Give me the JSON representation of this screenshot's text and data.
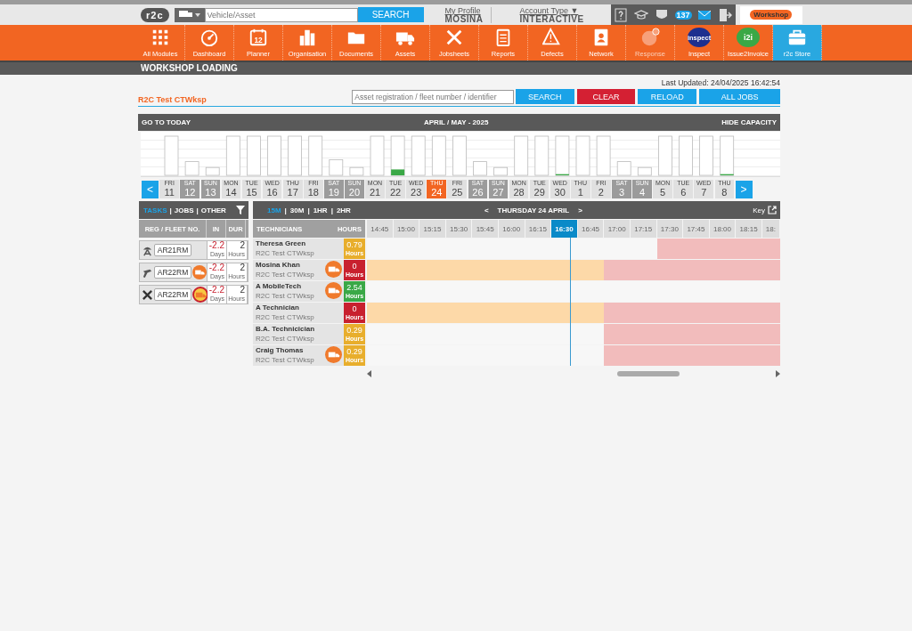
{
  "header": {
    "logo": "r2c",
    "search": {
      "placeholder": "Vehicle/Asset",
      "button": "SEARCH"
    },
    "profile": {
      "link": "My Profile",
      "name": "MOSINA"
    },
    "account": {
      "link": "Account Type",
      "caret": "▼",
      "value": "INTERACTIVE"
    },
    "notification_count": "137",
    "workshop_logo": "Workshop"
  },
  "nav": [
    {
      "label": "All Modules",
      "selected": false,
      "disabled": false
    },
    {
      "label": "Dashboard",
      "selected": false,
      "disabled": false
    },
    {
      "label": "Planner",
      "selected": false,
      "disabled": false,
      "icon_text": "12"
    },
    {
      "label": "Organisation",
      "selected": false,
      "disabled": false
    },
    {
      "label": "Documents",
      "selected": false,
      "disabled": false
    },
    {
      "label": "Assets",
      "selected": false,
      "disabled": false
    },
    {
      "label": "Jobsheets",
      "selected": false,
      "disabled": false
    },
    {
      "label": "Reports",
      "selected": false,
      "disabled": false
    },
    {
      "label": "Defects",
      "selected": false,
      "disabled": false
    },
    {
      "label": "Network",
      "selected": false,
      "disabled": false
    },
    {
      "label": "Response",
      "selected": false,
      "disabled": true
    },
    {
      "label": "Inspect",
      "selected": false,
      "disabled": false,
      "logo_text": "inspect"
    },
    {
      "label": "Issue2Invoice",
      "selected": false,
      "disabled": false,
      "logo_text": "i2i"
    },
    {
      "label": "r2c Store",
      "selected": true,
      "disabled": false
    }
  ],
  "page_title": "WORKSHOP LOADING",
  "last_updated": "Last Updated: 24/04/2025 16:42:54",
  "workshop_name": "R2C Test CTWksp",
  "job_search": {
    "placeholder": "Asset registration / fleet number / identifier",
    "buttons": [
      {
        "label": "SEARCH",
        "kind": "primary"
      },
      {
        "label": "CLEAR",
        "kind": "danger"
      },
      {
        "label": "RELOAD",
        "kind": "primary"
      },
      {
        "label": "ALL JOBS",
        "kind": "primary"
      }
    ]
  },
  "calendar": {
    "go_to_today": "GO TO TODAY",
    "month": "APRIL / MAY - 2025",
    "hide_capacity": "HIDE CAPACITY",
    "prev": "<",
    "next": ">",
    "days": [
      {
        "dow": "FRI",
        "day": "11",
        "weekend": false,
        "selected": false
      },
      {
        "dow": "SAT",
        "day": "12",
        "weekend": true,
        "selected": false
      },
      {
        "dow": "SUN",
        "day": "13",
        "weekend": true,
        "selected": false
      },
      {
        "dow": "MON",
        "day": "14",
        "weekend": false,
        "selected": false
      },
      {
        "dow": "TUE",
        "day": "15",
        "weekend": false,
        "selected": false
      },
      {
        "dow": "WED",
        "day": "16",
        "weekend": false,
        "selected": false
      },
      {
        "dow": "THU",
        "day": "17",
        "weekend": false,
        "selected": false
      },
      {
        "dow": "FRI",
        "day": "18",
        "weekend": false,
        "selected": false
      },
      {
        "dow": "SAT",
        "day": "19",
        "weekend": true,
        "selected": false
      },
      {
        "dow": "SUN",
        "day": "20",
        "weekend": true,
        "selected": false
      },
      {
        "dow": "MON",
        "day": "21",
        "weekend": false,
        "selected": false
      },
      {
        "dow": "TUE",
        "day": "22",
        "weekend": false,
        "selected": false
      },
      {
        "dow": "WED",
        "day": "23",
        "weekend": false,
        "selected": false
      },
      {
        "dow": "THU",
        "day": "24",
        "weekend": false,
        "selected": true
      },
      {
        "dow": "FRI",
        "day": "25",
        "weekend": false,
        "selected": false
      },
      {
        "dow": "SAT",
        "day": "26",
        "weekend": true,
        "selected": false
      },
      {
        "dow": "SUN",
        "day": "27",
        "weekend": true,
        "selected": false
      },
      {
        "dow": "MON",
        "day": "28",
        "weekend": false,
        "selected": false
      },
      {
        "dow": "TUE",
        "day": "29",
        "weekend": false,
        "selected": false
      },
      {
        "dow": "WED",
        "day": "30",
        "weekend": false,
        "selected": false
      },
      {
        "dow": "THU",
        "day": "1",
        "weekend": false,
        "selected": false
      },
      {
        "dow": "FRI",
        "day": "2",
        "weekend": false,
        "selected": false
      },
      {
        "dow": "SAT",
        "day": "3",
        "weekend": true,
        "selected": false
      },
      {
        "dow": "SUN",
        "day": "4",
        "weekend": true,
        "selected": false
      },
      {
        "dow": "MON",
        "day": "5",
        "weekend": false,
        "selected": false
      },
      {
        "dow": "TUE",
        "day": "6",
        "weekend": false,
        "selected": false
      },
      {
        "dow": "WED",
        "day": "7",
        "weekend": false,
        "selected": false
      },
      {
        "dow": "THU",
        "day": "8",
        "weekend": false,
        "selected": false
      }
    ]
  },
  "tasks": {
    "separator": "|",
    "tabs": [
      {
        "label": "TASKS",
        "selected": true
      },
      {
        "label": "JOBS",
        "selected": false
      },
      {
        "label": "OTHER",
        "selected": false
      }
    ],
    "columns": [
      "REG / FLEET NO.",
      "IN",
      "DUR"
    ],
    "rows": [
      {
        "kind": "dish",
        "reg": "AR21RM",
        "van": false,
        "in": "-2.2",
        "in_unit": "Days",
        "dur": "2",
        "dur_unit": "Hours"
      },
      {
        "kind": "spray",
        "reg": "AR22RM",
        "van": true,
        "highlighted": false,
        "in": "-2.2",
        "in_unit": "Days",
        "dur": "2",
        "dur_unit": "Hours"
      },
      {
        "kind": "tools",
        "reg": "AR22RM",
        "van": true,
        "highlighted": true,
        "in": "-2.2",
        "in_unit": "Days",
        "dur": "2",
        "dur_unit": "Hours"
      }
    ]
  },
  "schedule": {
    "separator": "|",
    "scales": [
      {
        "label": "15M",
        "selected": true
      },
      {
        "label": "30M",
        "selected": false
      },
      {
        "label": "1HR",
        "selected": false
      },
      {
        "label": "2HR",
        "selected": false
      }
    ],
    "prev": "<",
    "date": "THURSDAY 24 APRIL",
    "next": ">",
    "key": "Key",
    "columns": [
      "TECHNICIANS",
      "HOURS"
    ],
    "slots": [
      {
        "label": "14:45",
        "selected": false
      },
      {
        "label": "15:00",
        "selected": false
      },
      {
        "label": "15:15",
        "selected": false
      },
      {
        "label": "15:30",
        "selected": false
      },
      {
        "label": "15:45",
        "selected": false
      },
      {
        "label": "16:00",
        "selected": false
      },
      {
        "label": "16:15",
        "selected": false
      },
      {
        "label": "16:30",
        "selected": true
      },
      {
        "label": "16:45",
        "selected": false
      },
      {
        "label": "17:00",
        "selected": false
      },
      {
        "label": "17:15",
        "selected": false
      },
      {
        "label": "17:30",
        "selected": false
      },
      {
        "label": "17:45",
        "selected": false
      },
      {
        "label": "18:00",
        "selected": false
      },
      {
        "label": "18:15",
        "selected": false
      },
      {
        "label": "18:",
        "selected": false
      }
    ],
    "technicians": [
      {
        "name": "Theresa Green",
        "site": "R2C Test CTWksp",
        "van": false,
        "hours": "0.79",
        "hours_unit": "Hours",
        "color": "#e8ae2c",
        "cells": [
          {
            "kind": "free"
          },
          {
            "kind": "free"
          },
          {
            "kind": "free"
          },
          {
            "kind": "free"
          },
          {
            "kind": "free"
          },
          {
            "kind": "free"
          },
          {
            "kind": "free"
          },
          {
            "kind": "free"
          },
          {
            "kind": "free"
          },
          {
            "kind": "free"
          },
          {
            "kind": "free"
          },
          {
            "kind": "unavailable"
          },
          {
            "kind": "unavailable"
          },
          {
            "kind": "unavailable"
          },
          {
            "kind": "unavailable"
          },
          {
            "kind": "unavailable"
          }
        ]
      },
      {
        "name": "Mosina Khan",
        "site": "R2C Test CTWksp",
        "van": true,
        "hours": "0",
        "hours_unit": "Hours",
        "color": "#c8202e",
        "cells": [
          {
            "kind": "booked"
          },
          {
            "kind": "booked"
          },
          {
            "kind": "booked"
          },
          {
            "kind": "booked"
          },
          {
            "kind": "booked"
          },
          {
            "kind": "booked"
          },
          {
            "kind": "booked"
          },
          {
            "kind": "booked"
          },
          {
            "kind": "booked"
          },
          {
            "kind": "unavailable"
          },
          {
            "kind": "unavailable"
          },
          {
            "kind": "unavailable"
          },
          {
            "kind": "unavailable"
          },
          {
            "kind": "unavailable"
          },
          {
            "kind": "unavailable"
          },
          {
            "kind": "unavailable"
          }
        ]
      },
      {
        "name": "A MobileTech",
        "site": "R2C Test CTWksp",
        "van": true,
        "hours": "2.54",
        "hours_unit": "Hours",
        "color": "#3aa846",
        "cells": [
          {
            "kind": "free"
          },
          {
            "kind": "free"
          },
          {
            "kind": "free"
          },
          {
            "kind": "free"
          },
          {
            "kind": "free"
          },
          {
            "kind": "free"
          },
          {
            "kind": "free"
          },
          {
            "kind": "free"
          },
          {
            "kind": "free"
          },
          {
            "kind": "free"
          },
          {
            "kind": "free"
          },
          {
            "kind": "free"
          },
          {
            "kind": "free"
          },
          {
            "kind": "free"
          },
          {
            "kind": "free"
          },
          {
            "kind": "free"
          }
        ]
      },
      {
        "name": "A Technician",
        "site": "R2C Test CTWksp",
        "van": false,
        "hours": "0",
        "hours_unit": "Hours",
        "color": "#c8202e",
        "cells": [
          {
            "kind": "booked"
          },
          {
            "kind": "booked"
          },
          {
            "kind": "booked"
          },
          {
            "kind": "booked"
          },
          {
            "kind": "booked"
          },
          {
            "kind": "booked"
          },
          {
            "kind": "booked"
          },
          {
            "kind": "booked"
          },
          {
            "kind": "booked"
          },
          {
            "kind": "unavailable"
          },
          {
            "kind": "unavailable"
          },
          {
            "kind": "unavailable"
          },
          {
            "kind": "unavailable"
          },
          {
            "kind": "unavailable"
          },
          {
            "kind": "unavailable"
          },
          {
            "kind": "unavailable"
          }
        ]
      },
      {
        "name": "B.A. Technicician",
        "site": "R2C Test CTWksp",
        "van": false,
        "hours": "0.29",
        "hours_unit": "Hours",
        "color": "#e8ae2c",
        "cells": [
          {
            "kind": "free"
          },
          {
            "kind": "free"
          },
          {
            "kind": "free"
          },
          {
            "kind": "free"
          },
          {
            "kind": "free"
          },
          {
            "kind": "free"
          },
          {
            "kind": "free"
          },
          {
            "kind": "free"
          },
          {
            "kind": "free"
          },
          {
            "kind": "unavailable"
          },
          {
            "kind": "unavailable"
          },
          {
            "kind": "unavailable"
          },
          {
            "kind": "unavailable"
          },
          {
            "kind": "unavailable"
          },
          {
            "kind": "unavailable"
          },
          {
            "kind": "unavailable"
          }
        ]
      },
      {
        "name": "Craig Thomas",
        "site": "R2C Test CTWksp",
        "van": true,
        "hours": "0.29",
        "hours_unit": "Hours",
        "color": "#e8ae2c",
        "cells": [
          {
            "kind": "free"
          },
          {
            "kind": "free"
          },
          {
            "kind": "free"
          },
          {
            "kind": "free"
          },
          {
            "kind": "free"
          },
          {
            "kind": "free"
          },
          {
            "kind": "free"
          },
          {
            "kind": "free"
          },
          {
            "kind": "free"
          },
          {
            "kind": "unavailable"
          },
          {
            "kind": "unavailable"
          },
          {
            "kind": "unavailable"
          },
          {
            "kind": "unavailable"
          },
          {
            "kind": "unavailable"
          },
          {
            "kind": "unavailable"
          },
          {
            "kind": "unavailable"
          }
        ]
      }
    ]
  }
}
